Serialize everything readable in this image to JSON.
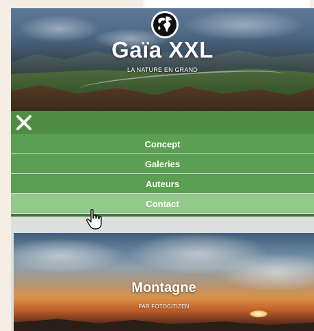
{
  "header": {
    "title": "Gaïa XXL",
    "tagline": "LA NATURE EN GRAND",
    "logo_icon": "globe-icon"
  },
  "menu": {
    "close_icon": "close-icon",
    "items": [
      {
        "label": "Concept",
        "active": false
      },
      {
        "label": "Galeries",
        "active": false
      },
      {
        "label": "Auteurs",
        "active": false
      },
      {
        "label": "Contact",
        "active": true
      }
    ],
    "colors": {
      "bar": "#4f8d45",
      "item": "#5ba052",
      "active": "#93c98a"
    }
  },
  "cursor_icon": "hand-pointer-icon",
  "gallery": {
    "card": {
      "title": "Montagne",
      "subtitle": "PAR FOTOCITIZEN"
    }
  }
}
